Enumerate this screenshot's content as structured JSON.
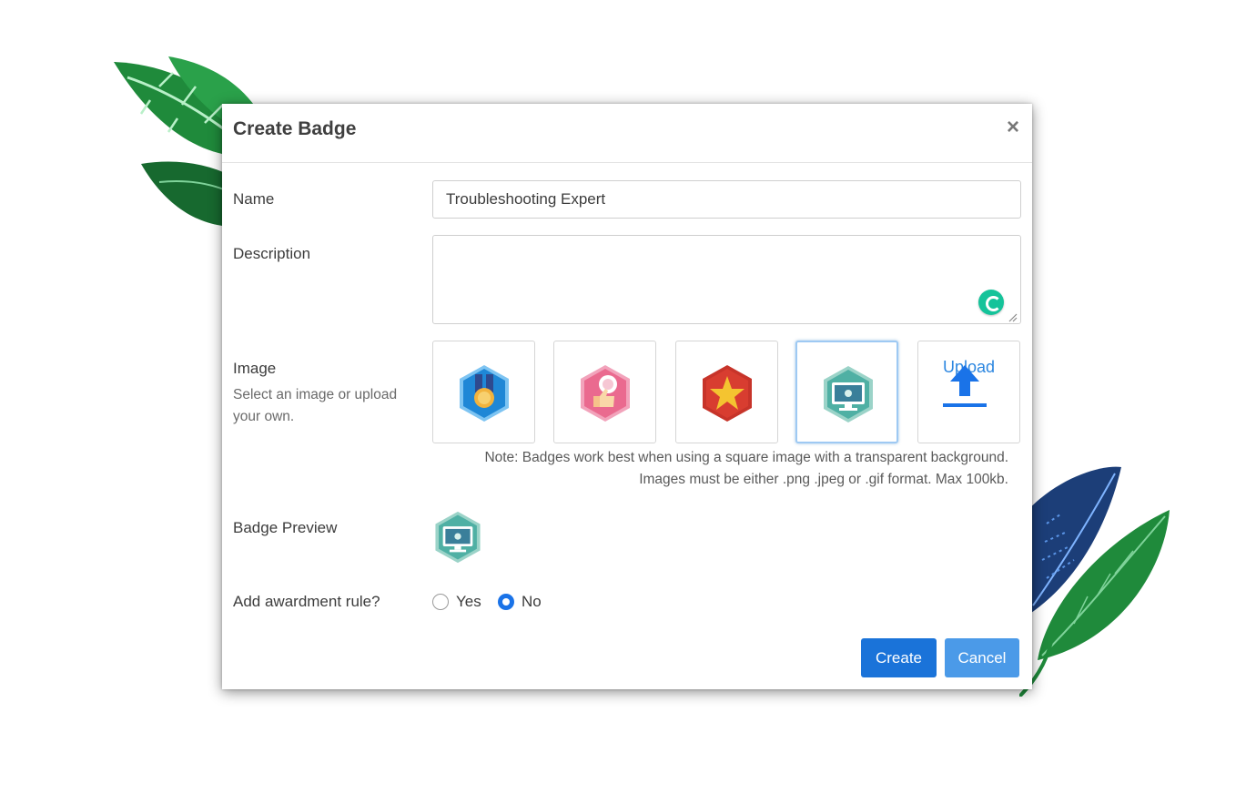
{
  "dialog": {
    "title": "Create Badge",
    "close_glyph": "×"
  },
  "form": {
    "name_label": "Name",
    "name_value": "Troubleshooting Expert",
    "description_label": "Description",
    "description_value": "",
    "image_label": "Image",
    "image_help": "Select an image or upload your own.",
    "badge_images": [
      {
        "icon": "medal-badge-icon",
        "color": "#1f87d6"
      },
      {
        "icon": "thumbs-up-badge-icon",
        "color": "#ea6a8f"
      },
      {
        "icon": "star-badge-icon",
        "color": "#d83d30"
      },
      {
        "icon": "computer-bug-badge-icon",
        "color": "#4fb0a4",
        "selected": true
      }
    ],
    "upload_label": "Upload",
    "note_line1": "Note: Badges work best when using a square image with a transparent background.",
    "note_line2": "Images must be either .png .jpeg or .gif format. Max 100kb.",
    "preview_label": "Badge Preview",
    "awardment_label": "Add awardment rule?",
    "awardment_options": [
      {
        "label": "Yes",
        "checked": false
      },
      {
        "label": "No",
        "checked": true
      }
    ]
  },
  "actions": {
    "create_label": "Create",
    "cancel_label": "Cancel"
  },
  "colors": {
    "primary": "#1a73d9",
    "secondary_button": "#4b9ae8",
    "link": "#2b86e0",
    "leaf_green": "#1f7a3a",
    "leaf_blue": "#1f4f8c"
  }
}
